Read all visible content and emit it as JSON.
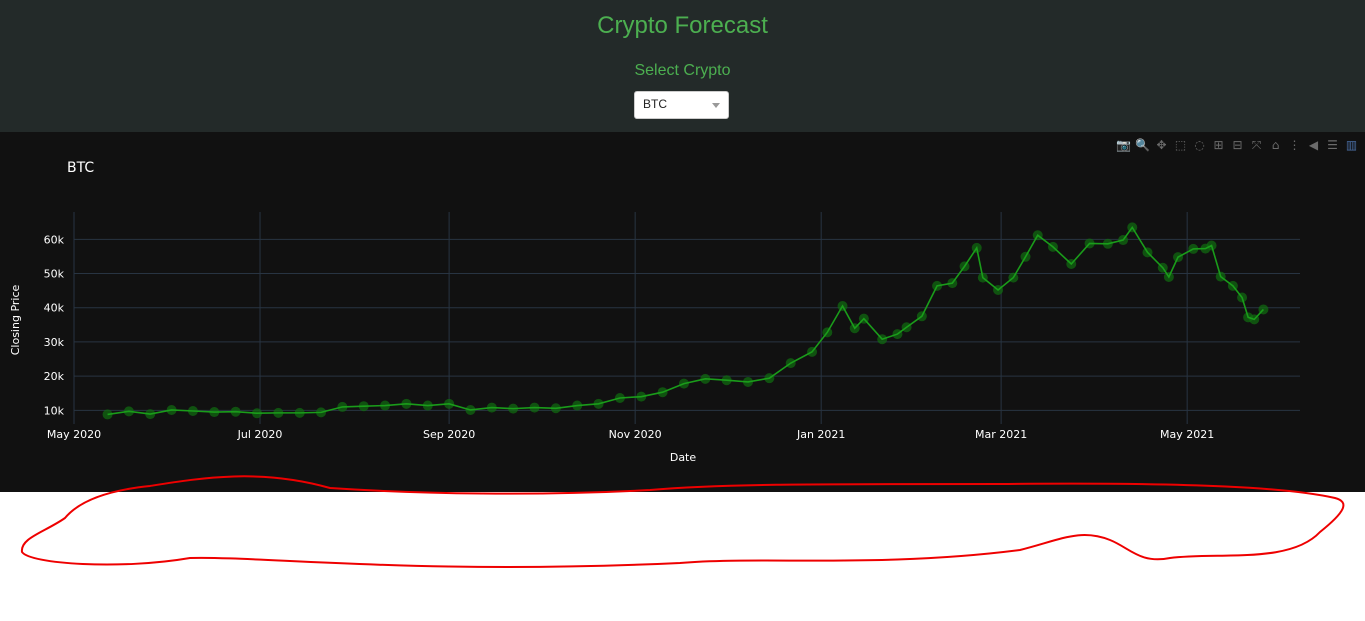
{
  "header": {
    "title": "Crypto Forecast",
    "select_label": "Select Crypto",
    "selected": "BTC"
  },
  "modebar": [
    "camera-icon",
    "zoom-icon",
    "pan-icon",
    "box-select-icon",
    "lasso-icon",
    "zoom-in-icon",
    "zoom-out-icon",
    "autoscale-icon",
    "reset-axes-icon",
    "spike-lines-icon",
    "hover-closest-icon",
    "hover-compare-icon",
    "plotly-logo-icon"
  ],
  "colors": {
    "line": "#1a9c1a",
    "marker": "#0f6e0f",
    "background": "#111111",
    "header": "#232a29",
    "accent": "#4caf50"
  },
  "chart_data": {
    "type": "line",
    "title": "BTC",
    "xlabel": "Date",
    "ylabel": "Closing Price",
    "xlim": [
      "2020-05-01",
      "2021-06-07"
    ],
    "ylim": [
      6000,
      68000
    ],
    "x_ticks": [
      "May 2020",
      "Jul 2020",
      "Sep 2020",
      "Nov 2020",
      "Jan 2021",
      "Mar 2021",
      "May 2021"
    ],
    "x_tick_dates": [
      "2020-05-01",
      "2020-07-01",
      "2020-09-01",
      "2020-11-01",
      "2021-01-01",
      "2021-03-01",
      "2021-05-01"
    ],
    "y_ticks": [
      "10k",
      "20k",
      "30k",
      "40k",
      "50k",
      "60k"
    ],
    "y_tick_values": [
      10000,
      20000,
      30000,
      40000,
      50000,
      60000
    ],
    "grid": true,
    "x": [
      "2020-05-12",
      "2020-05-19",
      "2020-05-26",
      "2020-06-02",
      "2020-06-09",
      "2020-06-16",
      "2020-06-23",
      "2020-06-30",
      "2020-07-07",
      "2020-07-14",
      "2020-07-21",
      "2020-07-28",
      "2020-08-04",
      "2020-08-11",
      "2020-08-18",
      "2020-08-25",
      "2020-09-01",
      "2020-09-08",
      "2020-09-15",
      "2020-09-22",
      "2020-09-29",
      "2020-10-06",
      "2020-10-13",
      "2020-10-20",
      "2020-10-27",
      "2020-11-03",
      "2020-11-10",
      "2020-11-17",
      "2020-11-24",
      "2020-12-01",
      "2020-12-08",
      "2020-12-15",
      "2020-12-22",
      "2020-12-29",
      "2021-01-03",
      "2021-01-08",
      "2021-01-12",
      "2021-01-15",
      "2021-01-21",
      "2021-01-26",
      "2021-01-29",
      "2021-02-03",
      "2021-02-08",
      "2021-02-13",
      "2021-02-17",
      "2021-02-21",
      "2021-02-23",
      "2021-02-28",
      "2021-03-05",
      "2021-03-09",
      "2021-03-13",
      "2021-03-18",
      "2021-03-24",
      "2021-03-30",
      "2021-04-05",
      "2021-04-10",
      "2021-04-13",
      "2021-04-18",
      "2021-04-23",
      "2021-04-25",
      "2021-04-28",
      "2021-05-03",
      "2021-05-07",
      "2021-05-09",
      "2021-05-12",
      "2021-05-16",
      "2021-05-19",
      "2021-05-21",
      "2021-05-23",
      "2021-05-26"
    ],
    "values": [
      8800,
      9700,
      8900,
      10100,
      9800,
      9500,
      9600,
      9150,
      9250,
      9250,
      9400,
      11000,
      11200,
      11400,
      11900,
      11400,
      11900,
      10100,
      10800,
      10500,
      10800,
      10600,
      11400,
      11900,
      13600,
      14000,
      15300,
      17800,
      19200,
      18800,
      18300,
      19400,
      23800,
      27100,
      32800,
      40500,
      34000,
      36800,
      30800,
      32300,
      34300,
      37500,
      46400,
      47200,
      52100,
      57500,
      48800,
      45200,
      48800,
      54900,
      61200,
      57800,
      52800,
      58800,
      58700,
      59800,
      63500,
      56200,
      51700,
      49000,
      54800,
      57200,
      57300,
      58200,
      49100,
      46400,
      43000,
      37200,
      36600,
      39500
    ]
  }
}
